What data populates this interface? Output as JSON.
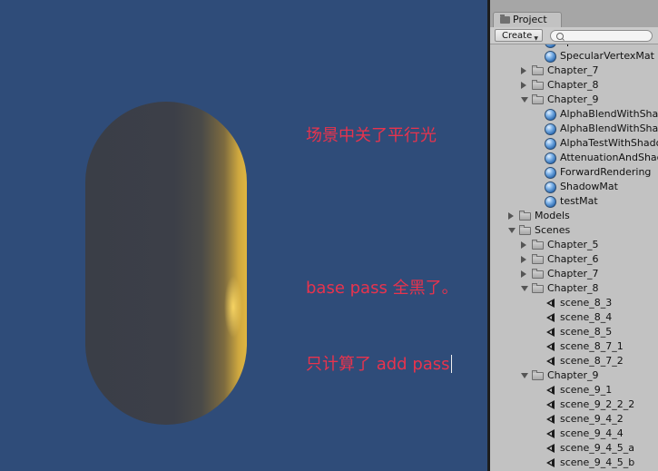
{
  "scene": {
    "note_lines": [
      "场景中关了平行光",
      "",
      "base pass 全黑了。",
      "只计算了 add pass"
    ]
  },
  "project": {
    "tab_label": "Project",
    "create_label": "Create",
    "search_placeholder": "",
    "items": [
      {
        "label": "SpecularVertexLevel",
        "kind": "material",
        "depth": 3,
        "arrow": "none"
      },
      {
        "label": "SpecularVertexMat",
        "kind": "material",
        "depth": 3,
        "arrow": "none"
      },
      {
        "label": "Chapter_7",
        "kind": "folder",
        "depth": 2,
        "arrow": "collapsed"
      },
      {
        "label": "Chapter_8",
        "kind": "folder",
        "depth": 2,
        "arrow": "collapsed"
      },
      {
        "label": "Chapter_9",
        "kind": "folder",
        "depth": 2,
        "arrow": "expanded"
      },
      {
        "label": "AlphaBlendWithShadow",
        "kind": "material",
        "depth": 3,
        "arrow": "none"
      },
      {
        "label": "AlphaBlendWithShadowMat",
        "kind": "material",
        "depth": 3,
        "arrow": "none"
      },
      {
        "label": "AlphaTestWithShadow",
        "kind": "material",
        "depth": 3,
        "arrow": "none"
      },
      {
        "label": "AttenuationAndShadowMat",
        "kind": "material",
        "depth": 3,
        "arrow": "none"
      },
      {
        "label": "ForwardRendering",
        "kind": "material",
        "depth": 3,
        "arrow": "none"
      },
      {
        "label": "ShadowMat",
        "kind": "material",
        "depth": 3,
        "arrow": "none"
      },
      {
        "label": "testMat",
        "kind": "material",
        "depth": 3,
        "arrow": "none"
      },
      {
        "label": "Models",
        "kind": "folder",
        "depth": 1,
        "arrow": "collapsed"
      },
      {
        "label": "Scenes",
        "kind": "folder",
        "depth": 1,
        "arrow": "expanded"
      },
      {
        "label": "Chapter_5",
        "kind": "folder",
        "depth": 2,
        "arrow": "collapsed"
      },
      {
        "label": "Chapter_6",
        "kind": "folder",
        "depth": 2,
        "arrow": "collapsed"
      },
      {
        "label": "Chapter_7",
        "kind": "folder",
        "depth": 2,
        "arrow": "collapsed"
      },
      {
        "label": "Chapter_8",
        "kind": "folder",
        "depth": 2,
        "arrow": "expanded"
      },
      {
        "label": "scene_8_3",
        "kind": "scene",
        "depth": 3,
        "arrow": "none"
      },
      {
        "label": "scene_8_4",
        "kind": "scene",
        "depth": 3,
        "arrow": "none"
      },
      {
        "label": "scene_8_5",
        "kind": "scene",
        "depth": 3,
        "arrow": "none"
      },
      {
        "label": "scene_8_7_1",
        "kind": "scene",
        "depth": 3,
        "arrow": "none"
      },
      {
        "label": "scene_8_7_2",
        "kind": "scene",
        "depth": 3,
        "arrow": "none"
      },
      {
        "label": "Chapter_9",
        "kind": "folder",
        "depth": 2,
        "arrow": "expanded"
      },
      {
        "label": "scene_9_1",
        "kind": "scene",
        "depth": 3,
        "arrow": "none"
      },
      {
        "label": "scene_9_2_2_2",
        "kind": "scene",
        "depth": 3,
        "arrow": "none"
      },
      {
        "label": "scene_9_4_2",
        "kind": "scene",
        "depth": 3,
        "arrow": "none"
      },
      {
        "label": "scene_9_4_4",
        "kind": "scene",
        "depth": 3,
        "arrow": "none"
      },
      {
        "label": "scene_9_4_5_a",
        "kind": "scene",
        "depth": 3,
        "arrow": "none"
      },
      {
        "label": "scene_9_4_5_b",
        "kind": "scene",
        "depth": 3,
        "arrow": "none"
      }
    ]
  },
  "colors": {
    "scene_background": "#2f4c79",
    "note_text": "#e8334d",
    "panel_background": "#c2c2c2"
  }
}
